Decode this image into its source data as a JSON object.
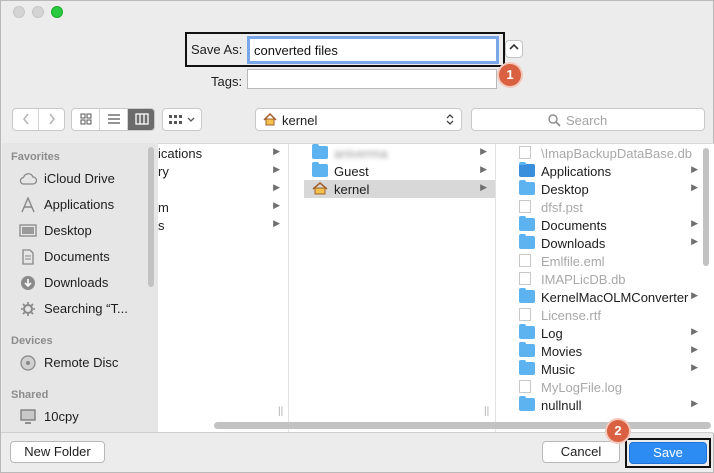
{
  "dialog": {
    "save_as_label": "Save As:",
    "save_as_value": "converted files",
    "tags_label": "Tags:",
    "tags_value": ""
  },
  "toolbar": {
    "location": "kernel",
    "search_placeholder": "Search"
  },
  "sidebar": {
    "favorites_header": "Favorites",
    "favorites": [
      {
        "label": "iCloud Drive",
        "icon": "cloud-icon"
      },
      {
        "label": "Applications",
        "icon": "applications-icon"
      },
      {
        "label": "Desktop",
        "icon": "desktop-icon"
      },
      {
        "label": "Documents",
        "icon": "documents-icon"
      },
      {
        "label": "Downloads",
        "icon": "downloads-icon"
      },
      {
        "label": "Searching “T...",
        "icon": "gear-icon"
      }
    ],
    "devices_header": "Devices",
    "devices": [
      {
        "label": "Remote Disc",
        "icon": "disc-icon"
      }
    ],
    "shared_header": "Shared",
    "shared": [
      {
        "label": "10cpy",
        "icon": "computer-icon"
      }
    ]
  },
  "columns": {
    "col1": [
      "ications",
      "ry",
      "",
      "m",
      "s"
    ],
    "col2": [
      "aniverma",
      "Guest",
      "kernel"
    ],
    "col3": [
      {
        "name": "\\ImapBackupDataBase.db",
        "type": "doc",
        "dim": true,
        "arrow": false
      },
      {
        "name": "Applications",
        "type": "app",
        "dim": false,
        "arrow": true
      },
      {
        "name": "Desktop",
        "type": "folder",
        "dim": false,
        "arrow": true
      },
      {
        "name": "dfsf.pst",
        "type": "doc",
        "dim": true,
        "arrow": false
      },
      {
        "name": "Documents",
        "type": "folder",
        "dim": false,
        "arrow": true
      },
      {
        "name": "Downloads",
        "type": "folder",
        "dim": false,
        "arrow": true
      },
      {
        "name": "Emlfile.eml",
        "type": "doc",
        "dim": true,
        "arrow": false
      },
      {
        "name": "IMAPLicDB.db",
        "type": "doc",
        "dim": true,
        "arrow": false
      },
      {
        "name": "KernelMacOLMConverter",
        "type": "folder",
        "dim": false,
        "arrow": true
      },
      {
        "name": "License.rtf",
        "type": "doc",
        "dim": true,
        "arrow": false
      },
      {
        "name": "Log",
        "type": "folder",
        "dim": false,
        "arrow": true
      },
      {
        "name": "Movies",
        "type": "folder",
        "dim": false,
        "arrow": true
      },
      {
        "name": "Music",
        "type": "folder",
        "dim": false,
        "arrow": true
      },
      {
        "name": "MyLogFile.log",
        "type": "doc",
        "dim": true,
        "arrow": false
      },
      {
        "name": "nullnull",
        "type": "folder",
        "dim": false,
        "arrow": true
      }
    ]
  },
  "buttons": {
    "new_folder": "New Folder",
    "cancel": "Cancel",
    "save": "Save"
  },
  "badges": [
    "1",
    "2"
  ],
  "colors": {
    "accent": "#2d8cf4",
    "badge": "#d96040",
    "folder": "#5cb3f0"
  }
}
